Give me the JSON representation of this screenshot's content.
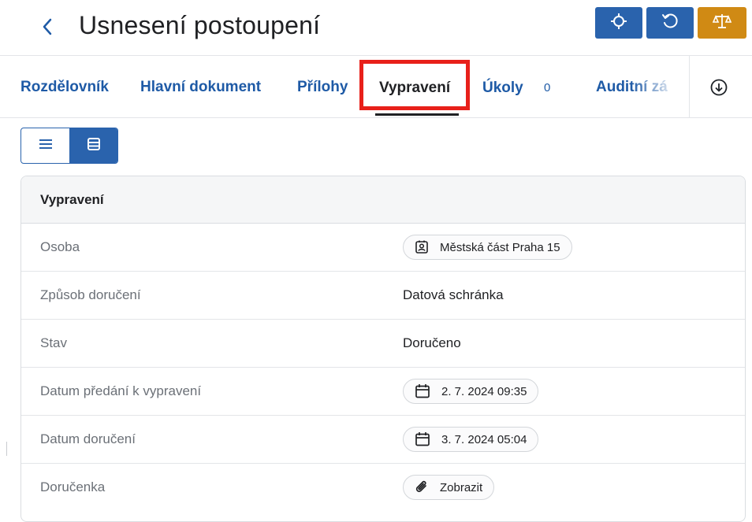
{
  "header": {
    "title": "Usnesení postoupení",
    "back_icon": "chevron-left-icon",
    "actions": [
      {
        "icon": "crosshair-icon",
        "color": "#2a63ad"
      },
      {
        "icon": "refresh-icon",
        "color": "#2a63ad"
      },
      {
        "icon": "scales-icon",
        "color": "#d08a14"
      }
    ]
  },
  "tabs": {
    "items": [
      {
        "label": "Rozdělovník"
      },
      {
        "label": "Hlavní dokument"
      },
      {
        "label": "Přílohy"
      },
      {
        "label": "Vypravení",
        "active": true
      },
      {
        "label": "Úkoly"
      },
      {
        "label": "Auditní zá"
      }
    ],
    "ukoly_count": "0",
    "scroll_icon": "circle-arrow-down-icon",
    "highlight_color": "#e8201a"
  },
  "view_toggle": {
    "options": [
      {
        "icon": "list-icon",
        "active": false
      },
      {
        "icon": "table-icon",
        "active": true
      }
    ]
  },
  "detail": {
    "header": "Vypravení",
    "rows": [
      {
        "label": "Osoba",
        "value": "Městská část Praha 15",
        "chip_icon": "contact-icon"
      },
      {
        "label": "Způsob doručení",
        "value": "Datová schránka"
      },
      {
        "label": "Stav",
        "value": "Doručeno"
      },
      {
        "label": "Datum předání k vypravení",
        "value": "2. 7. 2024 09:35",
        "chip_icon": "calendar-icon"
      },
      {
        "label": "Datum doručení",
        "value": "3. 7. 2024 05:04",
        "chip_icon": "calendar-icon"
      },
      {
        "label": "Doručenka",
        "value": "Zobrazit",
        "chip_icon": "paperclip-icon"
      }
    ]
  },
  "colors": {
    "primary": "#2a63ad",
    "link": "#1e5aa6",
    "accent_orange": "#d08a14"
  }
}
